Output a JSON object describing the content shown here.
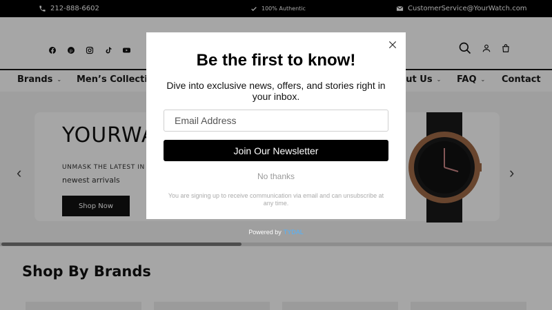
{
  "topbar": {
    "phone": "212-888-6602",
    "authentic": "100% Authentic",
    "email": "CustomerService@YourWatch.com"
  },
  "nav": {
    "items": [
      {
        "label": "Brands"
      },
      {
        "label": "Men’s Collection"
      },
      {
        "label": "About Us"
      },
      {
        "label": "FAQ"
      },
      {
        "label": "Contact"
      }
    ]
  },
  "hero": {
    "title": "YOURWA",
    "subtitle": "UNMASK THE LATEST IN L",
    "subtitle2": "newest arrivals",
    "button": "Shop Now"
  },
  "section": {
    "title": "Shop By Brands"
  },
  "popup": {
    "title": "Be the first to know!",
    "description": "Dive into exclusive news, offers, and stories right in your inbox.",
    "email_placeholder": "Email Address",
    "email_value": "",
    "join_button": "Join Our Newsletter",
    "no_thanks": "No thanks",
    "disclaimer": "You are signing up to receive communication via email and can unsubscribe at any time.",
    "powered_by": "Powered by",
    "powered_brand": "TYDAL"
  },
  "colors": {
    "accent": "#000000",
    "link": "#4fb3ff",
    "overlay": "rgba(0,0,0,0.35)"
  },
  "icons": [
    "phone-icon",
    "check-icon",
    "mail-icon",
    "facebook-icon",
    "pinterest-icon",
    "instagram-icon",
    "tiktok-icon",
    "youtube-icon",
    "search-icon",
    "account-icon",
    "cart-icon",
    "close-icon",
    "chevron-left-icon",
    "chevron-right-icon"
  ]
}
